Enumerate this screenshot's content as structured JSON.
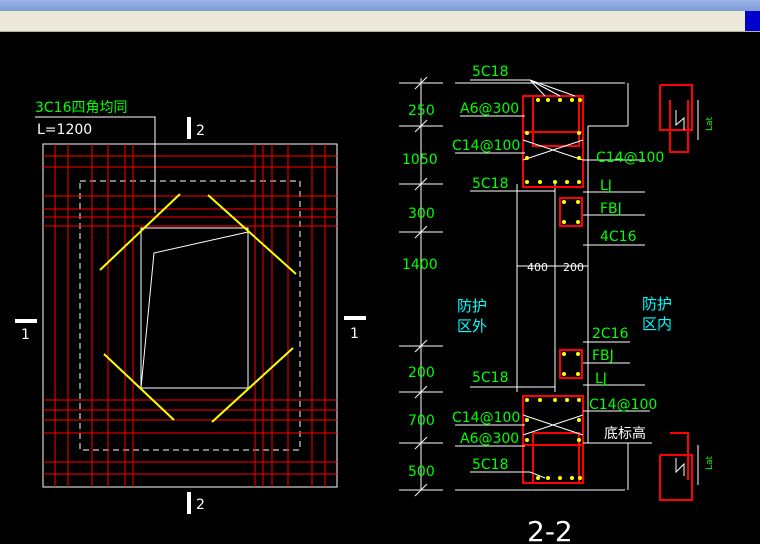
{
  "colors": {
    "background": "#000000",
    "line_white": "#ffffff",
    "rebar_red": "#ff0000",
    "rebar_yellow": "#ffff00",
    "text_green": "#00ff00",
    "text_cyan": "#00ffff"
  },
  "plan": {
    "rebar_note": "3C16四角均同",
    "length_note": "L=1200",
    "section_mark_top": "2",
    "section_mark_bottom": "2",
    "section_mark_left": "1",
    "section_mark_right": "1"
  },
  "section": {
    "title": "2-2",
    "dimensions": [
      "250",
      "1050",
      "300",
      "1400",
      "200",
      "700",
      "500"
    ],
    "width_dims": [
      "400",
      "200"
    ],
    "labels": {
      "top_bars": "5C18",
      "stirrup_top": "A6@300",
      "side_top_left": "C14@100",
      "side_top_right": "C14@100",
      "bottom_bars_top_beam": "5C18",
      "lj_top": "LJ",
      "fbj_top": "FBJ",
      "bars_4c16": "4C16",
      "bars_2c16": "2C16",
      "fbj_bottom": "FBJ",
      "lj_bottom": "LJ",
      "top_bars_bottom_beam": "5C18",
      "side_bottom_left": "C14@100",
      "side_bottom_right": "C14@100",
      "stirrup_bottom": "A6@300",
      "bottom_bars": "5C18",
      "outside_zone": "防护\n区外",
      "inside_zone": "防护\n区内",
      "bottom_elevation": "底标高",
      "anchor_top": "Lat",
      "anchor_bottom": "Lat"
    }
  }
}
